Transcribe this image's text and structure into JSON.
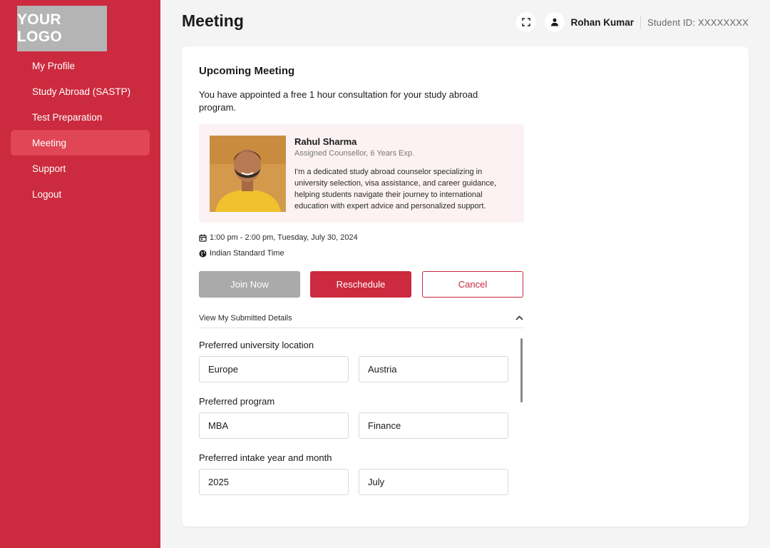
{
  "logo_text": "YOUR LOGO",
  "sidebar": {
    "items": [
      {
        "label": "My Profile"
      },
      {
        "label": "Study Abroad (SASTP)"
      },
      {
        "label": "Test Preparation"
      },
      {
        "label": "Meeting",
        "active": true
      },
      {
        "label": "Support"
      },
      {
        "label": "Logout"
      }
    ]
  },
  "header": {
    "title": "Meeting",
    "user_name": "Rohan Kumar",
    "student_id": "Student ID: XXXXXXXX"
  },
  "meeting": {
    "section_title": "Upcoming Meeting",
    "intro": "You have appointed a free 1 hour consultation for your study abroad program.",
    "counsellor": {
      "name": "Rahul Sharma",
      "role": "Assigned Counsellor, 6 Years Exp.",
      "bio": "I'm a dedicated study abroad counselor specializing in university selection, visa assistance, and career guidance, helping students navigate their journey to international education with expert advice and personalized support."
    },
    "time": "1:00 pm - 2:00 pm, Tuesday, July 30, 2024",
    "timezone": "Indian Standard Time",
    "buttons": {
      "join": "Join Now",
      "reschedule": "Reschedule",
      "cancel": "Cancel"
    },
    "details_toggle": "View My Submitted Details"
  },
  "details": {
    "location": {
      "label": "Preferred university location",
      "value1": "Europe",
      "value2": "Austria"
    },
    "program": {
      "label": "Preferred program",
      "value1": "MBA",
      "value2": "Finance"
    },
    "intake": {
      "label": "Preferred intake year and month",
      "value1": "2025",
      "value2": "July"
    }
  },
  "colors": {
    "brand": "#cc2a3e",
    "nav_active": "#e04656",
    "counsellor_bg": "#fdf2f3",
    "disabled_button": "#aaaaaa"
  },
  "icons": [
    "fullscreen-icon",
    "user-icon",
    "calendar-icon",
    "globe-icon",
    "chevron-up-icon"
  ]
}
